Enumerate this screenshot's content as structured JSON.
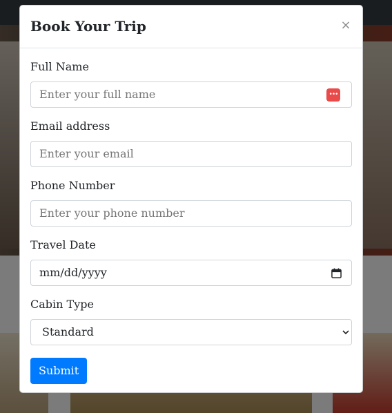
{
  "modal": {
    "title": "Book Your Trip",
    "close_label": "×"
  },
  "form": {
    "full_name": {
      "label": "Full Name",
      "placeholder": "Enter your full name"
    },
    "email": {
      "label": "Email address",
      "placeholder": "Enter your email"
    },
    "phone": {
      "label": "Phone Number",
      "placeholder": "Enter your phone number"
    },
    "travel_date": {
      "label": "Travel Date",
      "value": "mm/dd/yyyy"
    },
    "cabin_type": {
      "label": "Cabin Type",
      "selected": "Standard"
    },
    "submit_label": "Submit"
  },
  "colors": {
    "primary": "#007bff",
    "autofill_icon": "#e94a4a"
  },
  "icons": {
    "close": "close-icon",
    "autofill": "autofill-icon",
    "calendar": "calendar-icon",
    "select": "chevron-down-icon"
  }
}
